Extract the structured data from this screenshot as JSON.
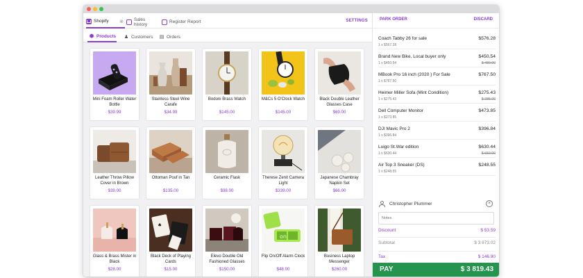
{
  "app_tabs": [
    {
      "label": "Shopify"
    },
    {
      "label": "Sales history"
    },
    {
      "label": "Register Report"
    }
  ],
  "settings_label": "SETTINGS",
  "sub_tabs": [
    {
      "label": "Products"
    },
    {
      "label": "Customers"
    },
    {
      "label": "Orders"
    }
  ],
  "products": [
    {
      "name": "Mini Foam Roller Water Bottle",
      "price": "$39.99"
    },
    {
      "name": "Stainless Steel Wine Carafe",
      "price": "$34.99"
    },
    {
      "name": "Bodoni Brass Watch",
      "price": "$145.00"
    },
    {
      "name": "M&Cs 5 O'Clock Watch",
      "price": "$145.00"
    },
    {
      "name": "Black Double Leather Glasses Case",
      "price": "$69.00"
    },
    {
      "name": "Leather Throw Pillow Cover in Brown",
      "price": "$39.00"
    },
    {
      "name": "Ottoman Pouf in Tan",
      "price": "$135.00"
    },
    {
      "name": "Ceramic Flask",
      "price": "$98.00"
    },
    {
      "name": "Therese Zenit Camera Light",
      "price": "$339.00"
    },
    {
      "name": "Japanese Chambray Napkin Set",
      "price": "$66.00"
    },
    {
      "name": "Glass & Brass Mister in Black",
      "price": "$28.00"
    },
    {
      "name": "Black Deck of Playing Cards",
      "price": "$15.00"
    },
    {
      "name": "Elevo Double Old Fashioned Glasses",
      "price": "$150.00"
    },
    {
      "name": "Flip On/Off Alarm Clock",
      "price": "$48.00"
    },
    {
      "name": "Business Laptop Messenger",
      "price": "$260.00"
    }
  ],
  "cart": {
    "park_label": "PARK ORDER",
    "discard_label": "DISCARD",
    "items": [
      {
        "name": "Coach Tabby 26 for sale",
        "qty": "1 x $567.28",
        "price": "$576.28",
        "original": ""
      },
      {
        "name": "Brand New Bike, Local buyer only",
        "qty": "1 x $450.54",
        "price": "$450.54",
        "original": "$ 480.00"
      },
      {
        "name": "MBook Pro 16 inch (2020 ) For Sale",
        "qty": "1 x $767.50",
        "price": "$767.50",
        "original": ""
      },
      {
        "name": "Heimer Miller Sofa (Mint Condition)",
        "qty": "1 x $275.43",
        "price": "$275.43",
        "original": "$ 285.00"
      },
      {
        "name": "Dell Computer Monitor",
        "qty": "1 x $273.85",
        "price": "$473.85",
        "original": ""
      },
      {
        "name": "DJI Mavic Pro 2",
        "qty": "1 x $396.84",
        "price": "$396.84",
        "original": ""
      },
      {
        "name": "Luigo St.War edition",
        "qty": "1 x $630.44",
        "price": "$630.44",
        "original": "$ 650.00"
      },
      {
        "name": "Air Top 3 Sneaker (DS)",
        "qty": "1 x $248.55",
        "price": "$248.55",
        "original": ""
      }
    ],
    "customer": "Christopher Plummer",
    "notes_placeholder": "Notes",
    "discount_label": "Discount",
    "discount_value": "$ 53.59",
    "subtotal_label": "Subtotal",
    "subtotal_value": "$ 3 873.02",
    "tax_label": "Tax",
    "tax_value": "$ 146.90",
    "pay_label": "PAY",
    "pay_value": "$ 3 819.43"
  },
  "colors": {
    "accent": "#8a3ad6",
    "pay": "#24944f"
  }
}
